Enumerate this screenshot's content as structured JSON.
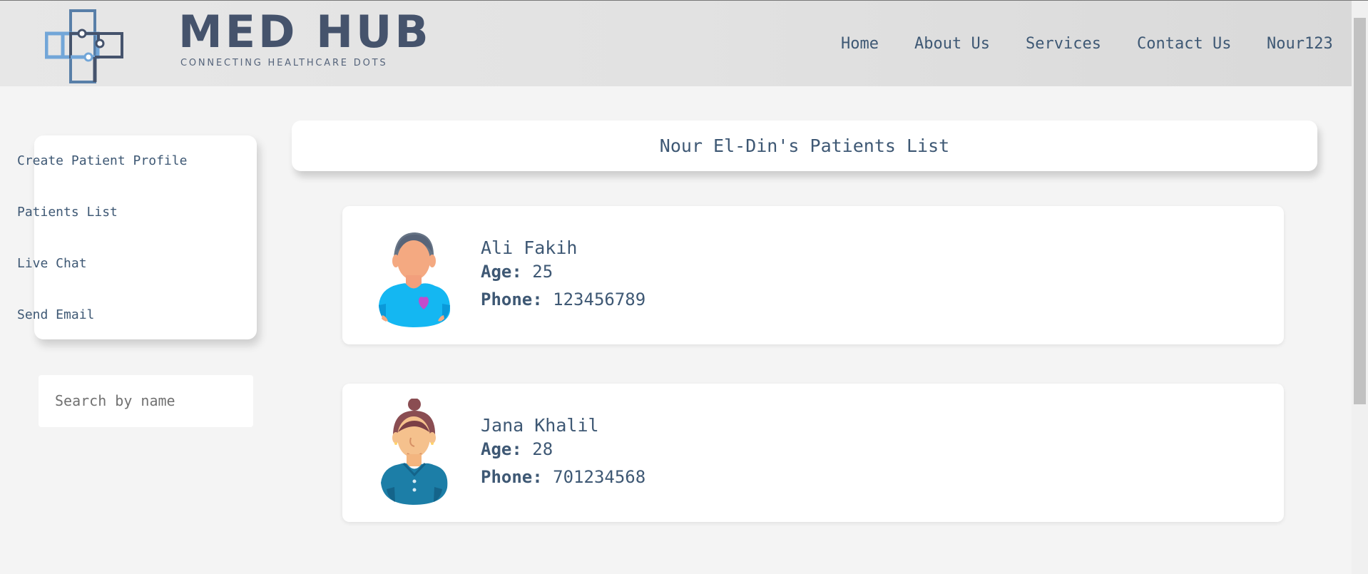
{
  "brand": {
    "name": "MED HUB",
    "tagline": "CONNECTING HEALTHCARE DOTS",
    "colors": {
      "dark_blue": "#45536c",
      "light_blue": "#72a6d8",
      "mid_blue": "#587fa8"
    }
  },
  "nav": {
    "home": "Home",
    "about": "About Us",
    "services": "Services",
    "contact": "Contact Us",
    "user": "Nour123"
  },
  "sidebar": {
    "items": [
      {
        "label": "Create Patient Profile"
      },
      {
        "label": "Patients List"
      },
      {
        "label": "Live Chat"
      },
      {
        "label": "Send Email"
      }
    ]
  },
  "search": {
    "placeholder": "Search by name"
  },
  "main": {
    "title": "Nour El-Din's Patients List",
    "patients": [
      {
        "name": "Ali Fakih",
        "age_label": "Age:",
        "age": "25",
        "phone_label": "Phone:",
        "phone": "123456789",
        "avatar_icon": "male-patient-avatar-icon"
      },
      {
        "name": "Jana Khalil",
        "age_label": "Age:",
        "age": "28",
        "phone_label": "Phone:",
        "phone": "701234568",
        "avatar_icon": "female-patient-avatar-icon"
      }
    ]
  },
  "colors": {
    "text": "#3e5874",
    "background": "#f4f4f4",
    "header": "#e2e2e2",
    "card": "#ffffff",
    "male_shirt": "#14b7f2",
    "female_shirt": "#1c7ea7",
    "heart": "#c24bcc"
  }
}
